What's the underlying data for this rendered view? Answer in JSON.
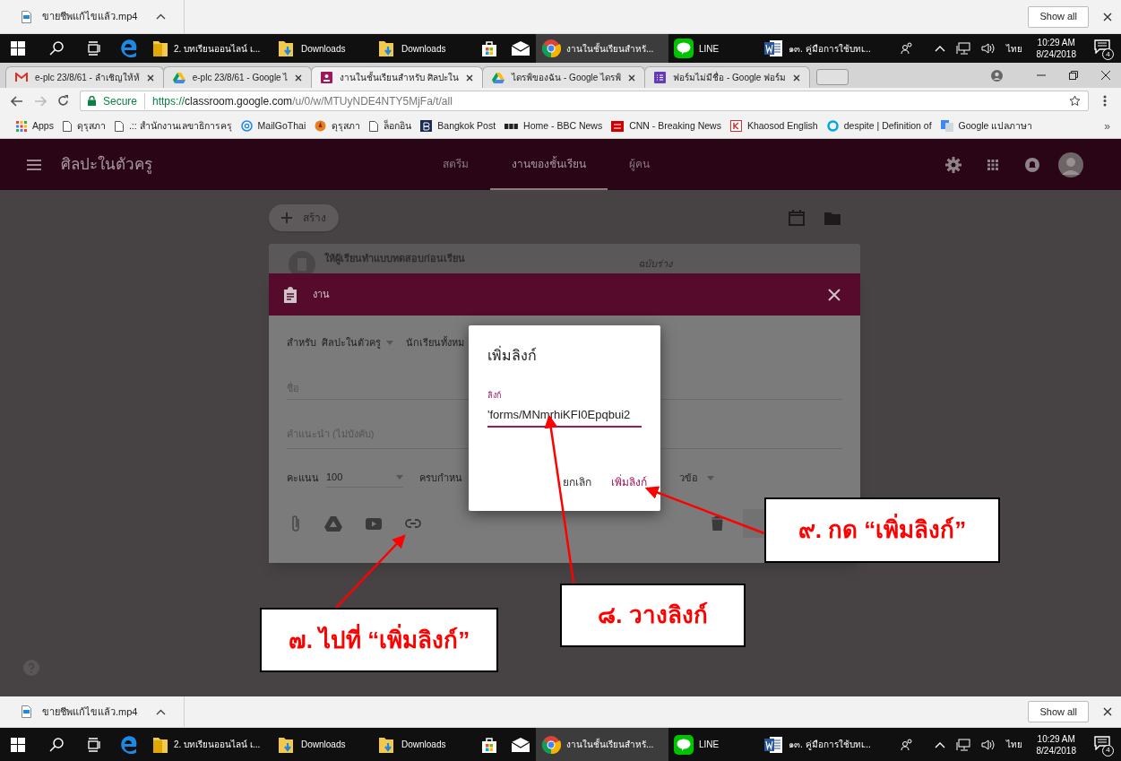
{
  "downloads_bar_top": {
    "file": "ขายชีพแก้ไขแล้ว.mp4",
    "show_all": "Show all"
  },
  "taskbar_top": {
    "items": [
      {
        "kind": "start",
        "selected": false
      },
      {
        "kind": "search",
        "selected": false
      },
      {
        "kind": "taskview",
        "selected": false
      },
      {
        "kind": "edge",
        "selected": false
      },
      {
        "kind": "folder",
        "label": "2. บทเรียนออนไลน์ เ...",
        "selected": false
      },
      {
        "kind": "downloads",
        "label": "Downloads",
        "selected": false
      },
      {
        "kind": "downloads",
        "label": "Downloads",
        "selected": false
      },
      {
        "kind": "store",
        "selected": false
      },
      {
        "kind": "mail",
        "selected": false
      },
      {
        "kind": "chrome",
        "label": "งานในชั้นเรียนสำหรั...",
        "selected": true
      },
      {
        "kind": "line",
        "label": "LINE",
        "selected": false
      },
      {
        "kind": "word",
        "label": "๑๓. คู่มือการใช้บทเ...",
        "selected": false
      }
    ],
    "tray": {
      "language": "ไทย",
      "time": "10:29 AM",
      "date": "8/24/2018",
      "notifications": "4"
    }
  },
  "browser": {
    "tabs": [
      {
        "kind": "gmail",
        "title": "e-plc 23/8/61 - ลำเชิญให้ห้",
        "selected": false
      },
      {
        "kind": "drive",
        "title": "e-plc 23/8/61 - Google ไ",
        "selected": false
      },
      {
        "kind": "classroom",
        "title": "งานในชั้นเรียนสำหรับ ศิลปะใน",
        "selected": true
      },
      {
        "kind": "drive",
        "title": "ไดรฟ์ของฉัน - Google ไดรฟ์",
        "selected": false
      },
      {
        "kind": "forms",
        "title": "ฟอร์มไม่มีชื่อ - Google ฟอร์ม",
        "selected": false
      }
    ],
    "address": {
      "secure": "Secure",
      "scheme": "https://",
      "host": "classroom.google.com",
      "path": "/u/0/w/MTUyNDE4NTY5MjFa/t/all"
    },
    "bookmarks": [
      {
        "kind": "apps",
        "label": "Apps"
      },
      {
        "kind": "page",
        "label": "ดุรุสภา"
      },
      {
        "kind": "page",
        "label": ".:: สำนักงานเลขาธิการครุ"
      },
      {
        "kind": "mailgothai",
        "label": "MailGoThai"
      },
      {
        "kind": "emblem",
        "label": "ดุรุสภา"
      },
      {
        "kind": "page",
        "label": "ล็อกอิน"
      },
      {
        "kind": "bangkokpost",
        "label": "Bangkok Post"
      },
      {
        "kind": "bbc",
        "label": "Home - BBC News"
      },
      {
        "kind": "cnn",
        "label": "CNN - Breaking News"
      },
      {
        "kind": "khaosod",
        "label": "Khaosod English"
      },
      {
        "kind": "despite",
        "label": "despite | Definition of"
      },
      {
        "kind": "translate",
        "label": "Google แปลภาษา"
      }
    ],
    "bookmarks_overflow": "»"
  },
  "classroom": {
    "title": "ศิลปะในตัวครู",
    "tabs": [
      {
        "label": "สตรีม",
        "selected": false
      },
      {
        "label": "งานของชั้นเรียน",
        "selected": true
      },
      {
        "label": "ผู้คน",
        "selected": false
      }
    ],
    "create": "สร้าง",
    "post": {
      "title": "ให้ผู้เรียนทำแบบทดสอบก่อนเรียน",
      "status": "ฉบับร่าง"
    },
    "editor": {
      "title": "งาน",
      "for_label": "สำหรับ",
      "class": "ศิลปะในตัวครู",
      "students": "นักเรียนทั้งหม",
      "title_placeholder": "ชื่อ",
      "instructions_placeholder": "คำแนะนำ (ไม่บังคับ)",
      "points_label": "คะแนน",
      "points": "100",
      "due_label": "ครบกำหน",
      "topic": "วข้อ"
    },
    "dialog": {
      "title": "เพิ่มลิงก์",
      "field_label": "ลิงก์",
      "value": "'forms/MNmrhiKFI0Epqbui2",
      "cancel": "ยกเลิก",
      "confirm": "เพิ่มลิงก์"
    }
  },
  "callouts": [
    {
      "text": "๙. กด “เพิ่มลิงก์”"
    },
    {
      "text": "๘. วางลิงก์"
    },
    {
      "text": "๗. ไปที่ “เพิ่มลิงก์”"
    }
  ],
  "downloads_bar_bottom": {
    "file": "ขายชีพแก้ไขแล้ว.mp4",
    "show_all": "Show all"
  },
  "taskbar_bottom": {
    "items": [
      {
        "kind": "start",
        "selected": false
      },
      {
        "kind": "search",
        "selected": false
      },
      {
        "kind": "taskview",
        "selected": false
      },
      {
        "kind": "edge",
        "selected": false
      },
      {
        "kind": "folder",
        "label": "2. บทเรียนออนไลน์ เ...",
        "selected": false
      },
      {
        "kind": "downloads",
        "label": "Downloads",
        "selected": false
      },
      {
        "kind": "downloads",
        "label": "Downloads",
        "selected": false
      },
      {
        "kind": "store",
        "selected": false
      },
      {
        "kind": "mail",
        "selected": false
      },
      {
        "kind": "chrome",
        "label": "งานในชั้นเรียนสำหรั...",
        "selected": true
      },
      {
        "kind": "line",
        "label": "LINE",
        "selected": false
      },
      {
        "kind": "word",
        "label": "๑๓. คู่มือการใช้บทเ...",
        "selected": false
      }
    ],
    "tray": {
      "language": "ไทย",
      "time": "10:29 AM",
      "date": "8/24/2018",
      "notifications": "4"
    }
  }
}
